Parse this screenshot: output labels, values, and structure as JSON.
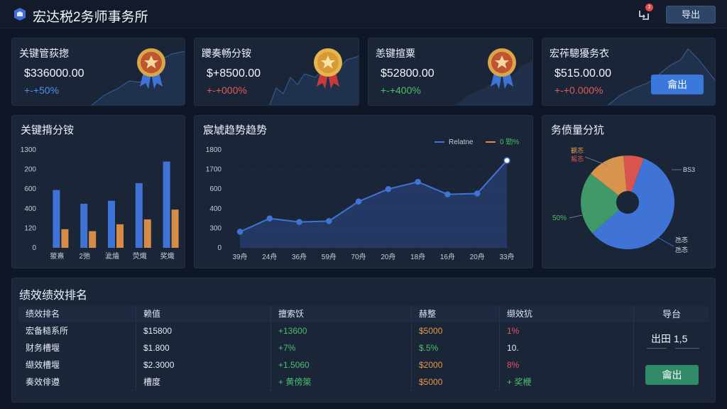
{
  "header": {
    "title": "宏达税2务师事务所",
    "notification_count": "3",
    "export_label": "导出"
  },
  "kpis": [
    {
      "title": "关键管荻揔",
      "value": "$336000.00",
      "change": "+-+50%",
      "change_color": "#4f8fe8",
      "medal": "bronze"
    },
    {
      "title": "躨奏畅分铵",
      "value": "$+8500.00",
      "change": "+-+000%",
      "change_color": "#e05a5a",
      "medal": "gold"
    },
    {
      "title": "恙键揎粟",
      "value": "$52800.00",
      "change": "+-+400%",
      "change_color": "#4cbe6c",
      "medal": "bronze"
    },
    {
      "title": "宏莋驄獶务衣",
      "value": "$515.00.00",
      "change": "+-+0.000%",
      "change_color": "#e05a5a",
      "button": "龠出"
    }
  ],
  "bar_panel": {
    "title": "关键揹分铵"
  },
  "line_panel": {
    "title": "宸虓趋势趋势"
  },
  "pie_panel": {
    "title": "务偾量分犺"
  },
  "chart_data": [
    {
      "type": "bar",
      "title": "关键揹分铵",
      "categories": [
        "猣熹",
        "2弛",
        "泚熆",
        "荧熾",
        "奖熾"
      ],
      "yticks": [
        "0",
        "120",
        "400",
        "600",
        "200",
        "1300"
      ],
      "series": [
        {
          "values": [
            590,
            450,
            480,
            660,
            880
          ],
          "color": "#3f74d6"
        },
        {
          "values": [
            190,
            170,
            240,
            290,
            390
          ],
          "color": "#d68b46"
        }
      ]
    },
    {
      "type": "area",
      "title": "宸虓趋势趋势",
      "categories": [
        "39舟",
        "24舟",
        "36舟",
        "59舟",
        "70舟",
        "20舟",
        "18舟",
        "16舟",
        "20舟",
        "33舟"
      ],
      "yticks": [
        "0",
        "300",
        "400",
        "600",
        "1700",
        "1800"
      ],
      "series": [
        {
          "name": "Relatne",
          "values": [
            180,
            330,
            290,
            300,
            520,
            660,
            740,
            600,
            610,
            980
          ],
          "color": "#3f74d6"
        }
      ],
      "legend_items": [
        "Relatne",
        "0 勁%"
      ],
      "legend_colors": [
        "#3f74d6",
        "#d68b46"
      ],
      "ylim": [
        0,
        1100
      ]
    },
    {
      "type": "pie",
      "title": "务偾量分犺",
      "slices": [
        {
          "label": "BS3",
          "value": 58,
          "color": "#3f74d6"
        },
        {
          "label": "50%",
          "value": 22,
          "color": "#3f9a68"
        },
        {
          "label": "覾忞",
          "value": 13,
          "color": "#d8934c"
        },
        {
          "label": "觢忞",
          "value": 7,
          "color": "#d9534f"
        }
      ],
      "labels": {
        "top_left": "覾忞\n觢忞",
        "right": "BS3",
        "left": "50%",
        "bottom_right": "氹忞\n氹忞"
      }
    }
  ],
  "ranking": {
    "title": "绩效绩效排名",
    "columns": [
      "绩效排名",
      "赖值",
      "擅索饫",
      "赫整",
      "缬效犺"
    ],
    "rows": [
      {
        "c0": "宏备糙系所",
        "c1": "$15800",
        "c2": "+13600",
        "c3": "$5000",
        "c4": "1%"
      },
      {
        "c0": "财务槽堰",
        "c1": "$1.800",
        "c2": "+7%",
        "c3": "$.5%",
        "c4": "10."
      },
      {
        "c0": "缬效槽堰",
        "c1": "$2.3000",
        "c2": "+1.5060",
        "c3": "$2000",
        "c4": "8%"
      },
      {
        "c0": "奏效俳遵",
        "c1": "槽度",
        "c2": "+ 黄傍箂",
        "c3": "$5000",
        "c4": "+ 奖楩"
      }
    ],
    "action_header": "导台",
    "action_label": "出田 1,5",
    "action_button": "龠出"
  }
}
